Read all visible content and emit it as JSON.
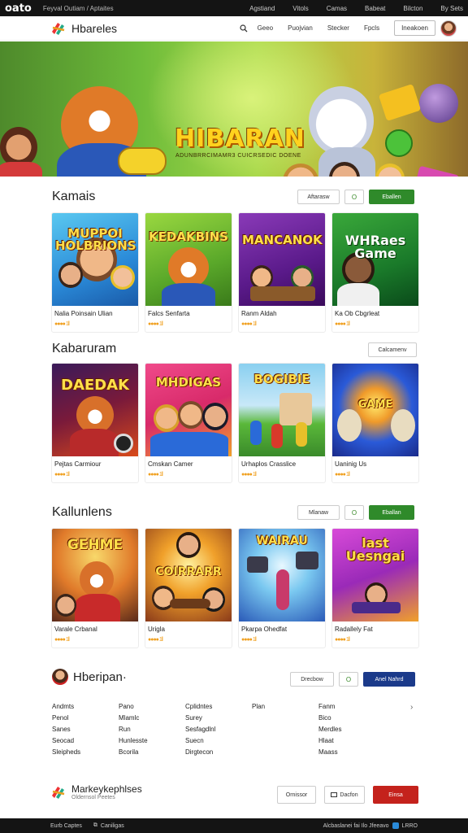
{
  "topbar": {
    "logo": "oato",
    "tagline": "Feyval Outiam / Aptaites",
    "links": [
      "Agstiand",
      "Vitols",
      "Camas",
      "Babeat",
      "Bilcton",
      "By Sets"
    ]
  },
  "header": {
    "brand": "Hbareles",
    "nav": [
      "Geeo",
      "Puojvian",
      "Stecker",
      "Fpcls"
    ],
    "button": "Ineakoen"
  },
  "hero": {
    "title": "HIBARAN",
    "subtitle": "ADUNBRRCIMAMR3 CUICRSEDIC DOENE"
  },
  "sections": [
    {
      "title": "Kamais",
      "controls": [
        "Aftarasw",
        "O",
        "Eballen"
      ],
      "cards": [
        {
          "thumb_text": "MUPPOI HOLBRIONS",
          "name": "Nalia Poinsain Ulian",
          "rating": "●●●● 1ll"
        },
        {
          "thumb_text": "KEDAKBINS",
          "name": "Falcs Senfarta",
          "rating": "●●●● 1ll"
        },
        {
          "thumb_text": "MANCANOK",
          "name": "Ranm Aldah",
          "rating": "●●●● 1ll"
        },
        {
          "thumb_text": "WHRaes Game",
          "name": "Ka Ob Cbgrleat",
          "rating": "●●●● 1ll"
        }
      ]
    },
    {
      "title": "Kabaruram",
      "controls": [
        "Calcamenv"
      ],
      "cards": [
        {
          "thumb_text": "DAEDAK",
          "name": "Pejtas Carmiour",
          "rating": "●●●● 1ll"
        },
        {
          "thumb_text": "MHDIGAS",
          "name": "Cmskan Camer",
          "rating": "●●●● 1ll"
        },
        {
          "thumb_text": "BOGIBIE",
          "name": "Urhaplos Crasslice",
          "rating": "●●●● 1ll"
        },
        {
          "thumb_text": "GAME",
          "name": "Uaninig Us",
          "rating": "●●●● 1ll"
        }
      ]
    },
    {
      "title": "Kallunlens",
      "controls": [
        "Mlanaw",
        "O",
        "Eballan"
      ],
      "cards": [
        {
          "thumb_text": "GEHME",
          "name": "Varale Crbanal",
          "rating": "●●●● 1ll"
        },
        {
          "thumb_text": "COIRRARR",
          "name": "Urigla",
          "rating": "●●●● 1ll"
        },
        {
          "thumb_text": "WAIRAU",
          "name": "Pkarpa Ohedfat",
          "rating": "●●●● 1ll"
        },
        {
          "thumb_text": "last Uesngai",
          "name": "Radallely Fat",
          "rating": "●●●● 1ll"
        }
      ]
    }
  ],
  "footer_section": {
    "title": "Hberipan·",
    "controls": [
      "Drecbow",
      "O",
      "Anel Nahrd"
    ],
    "columns": [
      [
        "Andmts",
        "Penol",
        "Sanes",
        "Seocad",
        "Sleipheds"
      ],
      [
        "Pano",
        "Mlamlc",
        "Run",
        "Hunlesste",
        "Bcorila"
      ],
      [
        "Cplidntes",
        "Surey",
        "Sesfagdlnl",
        "Suecn",
        "Dirgtecon"
      ],
      [
        "Plan"
      ],
      [
        "Fanm",
        "Bico",
        "Merdles",
        "Hlaat",
        "Maass"
      ]
    ]
  },
  "bottom": {
    "brand": "Markeykephlses",
    "brand_sub": "Oldernsol Peetes",
    "buttons": [
      "Ornissor",
      "Dacfon",
      "Einsa"
    ]
  },
  "bottombar": {
    "left": [
      "Eurb Captes",
      "Caniligas"
    ],
    "right": "Alcbaslanei fai Ilo Jfeeavo",
    "right2": "LRRO"
  }
}
